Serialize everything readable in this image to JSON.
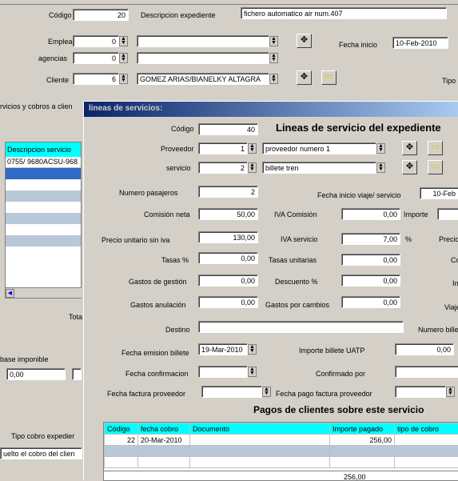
{
  "main": {
    "codigo_label": "Código",
    "codigo_value": "20",
    "descripcion_label": "Descripcion expediente",
    "descripcion_value": "fichero automatico air num.407",
    "empleado_label": "Empleado",
    "empleado_value": "0",
    "agencias_label": "agencias",
    "agencias_value": "0",
    "fecha_inicio_label": "Fecha inicio",
    "fecha_inicio_value": "10-Feb-2010",
    "cliente_label": "Cliente",
    "cliente_value": "6",
    "cliente_name": "GOMEZ ARIAS/BIANELKY ALTAGRA",
    "tipo_label": "Tipo",
    "servicios_label": "rvicios y cobros a clien",
    "list_header": "Descripcion servicio",
    "list_rows": [
      "0755/ 9680ACSU-968",
      "",
      "",
      "",
      "",
      "",
      "",
      "",
      "",
      "",
      ""
    ],
    "total_label": "Tota",
    "base_imponible_label": "base imponible",
    "base_imponible_value": "0,00",
    "tipo_cobro_label": "Tipo cobro expedier",
    "cobro_select_value": "uelto el cobro del clien"
  },
  "dialog": {
    "title": "lineas de servicios:",
    "heading": "Lineas de servicio del expediente",
    "codigo_label": "Código",
    "codigo_value": "40",
    "proveedor_label": "Proveedor",
    "proveedor_value": "1",
    "proveedor_name": "proveedor numero 1",
    "servicio_label": "servicio",
    "servicio_value": "2",
    "servicio_name": "billete tren",
    "num_pasajeros_label": "Numero pasajeros",
    "num_pasajeros_value": "2",
    "fecha_inicio_viaje_label": "Fecha inicio viaje/ servicio",
    "fecha_inicio_viaje_value": "10-Feb",
    "comision_neta_label": "Comisión neta",
    "comision_neta_value": "50,00",
    "iva_comision_label": "IVA Comisión",
    "iva_comision_value": "0,00",
    "importe_label": "Importe",
    "precio_unitario_label": "Precio unitario sin iva",
    "precio_unitario_value": "130,00",
    "iva_servicio_label": "IVA servicio",
    "iva_servicio_value": "7,00",
    "percent": "%",
    "precio_cut_label": "Precio",
    "tasas_label": "Tasas %",
    "tasas_value": "0,00",
    "tasas_unitarias_label": "Tasas unitarias",
    "tasas_unitarias_value": "0,00",
    "co_cut_label": "Co",
    "gastos_gestion_label": "Gastos de gestión",
    "gastos_gestion_value": "0,00",
    "descuento_label": "Descuento %",
    "descuento_value": "0,00",
    "im_cut_label": "Im",
    "gastos_anulacion_label": "Gastos anulación",
    "gastos_anulacion_value": "0,00",
    "gastos_cambios_label": "Gastos por cambios",
    "gastos_cambios_value": "0,00",
    "viaje_cut_label": "Viajer",
    "destino_label": "Destino",
    "destino_value": "",
    "numero_billete_label": "Numero bille",
    "fecha_emision_label": "Fecha emision billete",
    "fecha_emision_value": "19-Mar-2010",
    "importe_uatp_label": "Importe billete UATP",
    "importe_uatp_value": "0,00",
    "fecha_confirmacion_label": "Fecha confirmacion",
    "fecha_confirmacion_value": "",
    "confirmado_por_label": "Confirmado por",
    "fecha_factura_label": "Fecha factura proveedor",
    "fecha_pago_label": "Fecha pago factura proveedor",
    "pagos_heading": "Pagos de clientes sobre este servicio",
    "pagos_columns": [
      "Código",
      "fecha cobro",
      "Documento",
      "Importe pagado",
      "tipo de cobro"
    ],
    "pagos_rows": [
      [
        "22",
        "20-Mar-2010",
        "",
        "256,00",
        ""
      ]
    ],
    "pagos_total": "256,00"
  }
}
